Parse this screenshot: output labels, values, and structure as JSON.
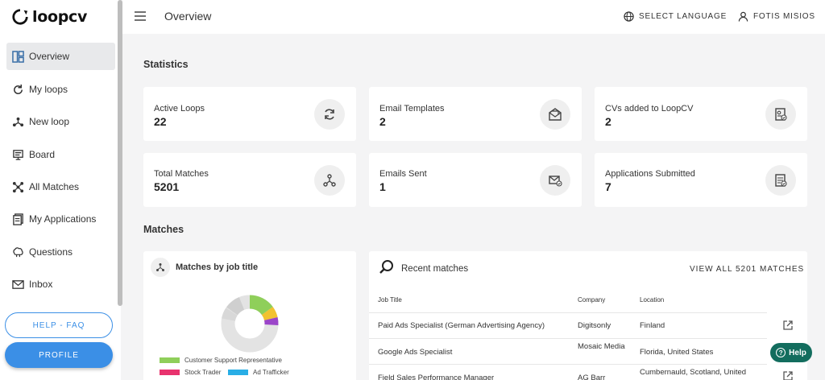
{
  "brand": {
    "name": "loopcv"
  },
  "sidebar": {
    "items": [
      {
        "label": "Overview",
        "icon": "dashboard-icon"
      },
      {
        "label": "My loops",
        "icon": "refresh-icon"
      },
      {
        "label": "New loop",
        "icon": "loop-nodes-icon"
      },
      {
        "label": "Board",
        "icon": "board-icon"
      },
      {
        "label": "All Matches",
        "icon": "network-icon"
      },
      {
        "label": "My Applications",
        "icon": "document-icon"
      },
      {
        "label": "Questions",
        "icon": "brain-icon"
      },
      {
        "label": "Inbox",
        "icon": "mail-icon"
      }
    ],
    "help_faq": "HELP - FAQ",
    "profile": "PROFILE"
  },
  "header": {
    "title": "Overview",
    "language": "SELECT LANGUAGE",
    "user": "FOTIS MISIOS"
  },
  "statistics": {
    "title": "Statistics",
    "cards": [
      {
        "label": "Active Loops",
        "value": "22",
        "icon": "refresh-icon"
      },
      {
        "label": "Email Templates",
        "value": "2",
        "icon": "envelope-open-icon"
      },
      {
        "label": "CVs added to LoopCV",
        "value": "2",
        "icon": "cv-icon"
      },
      {
        "label": "Total Matches",
        "value": "5201",
        "icon": "nodes-icon"
      },
      {
        "label": "Emails Sent",
        "value": "1",
        "icon": "mail-check-icon"
      },
      {
        "label": "Applications Submitted",
        "value": "7",
        "icon": "application-check-icon"
      }
    ]
  },
  "matches": {
    "title": "Matches",
    "by_job_title": {
      "title": "Matches by job title",
      "legend": [
        {
          "label": "Customer Support Representative",
          "color": "#8fcf5a"
        },
        {
          "label": "Stock Trader",
          "color": "#e8336e"
        },
        {
          "label": "Ad Trafficker",
          "color": "#29aee6"
        }
      ]
    },
    "recent": {
      "title": "Recent matches",
      "view_all": "VIEW ALL 5201 MATCHES",
      "columns": [
        "Job Title",
        "Company",
        "Location"
      ],
      "rows": [
        {
          "job": "Paid Ads Specialist (German Advertising Agency)",
          "company": "Digitsonly",
          "location": "Finland"
        },
        {
          "job": "Google Ads Specialist",
          "company": "Mosaic Media",
          "location": "Florida, United States"
        },
        {
          "job": "Field Sales Performance Manager",
          "company": "AG Barr",
          "location": "Cumbernauld, Scotland, United"
        }
      ]
    }
  },
  "help": {
    "label": "Help"
  },
  "colors": {
    "accent": "#3b8fe6",
    "help": "#136d5e"
  }
}
